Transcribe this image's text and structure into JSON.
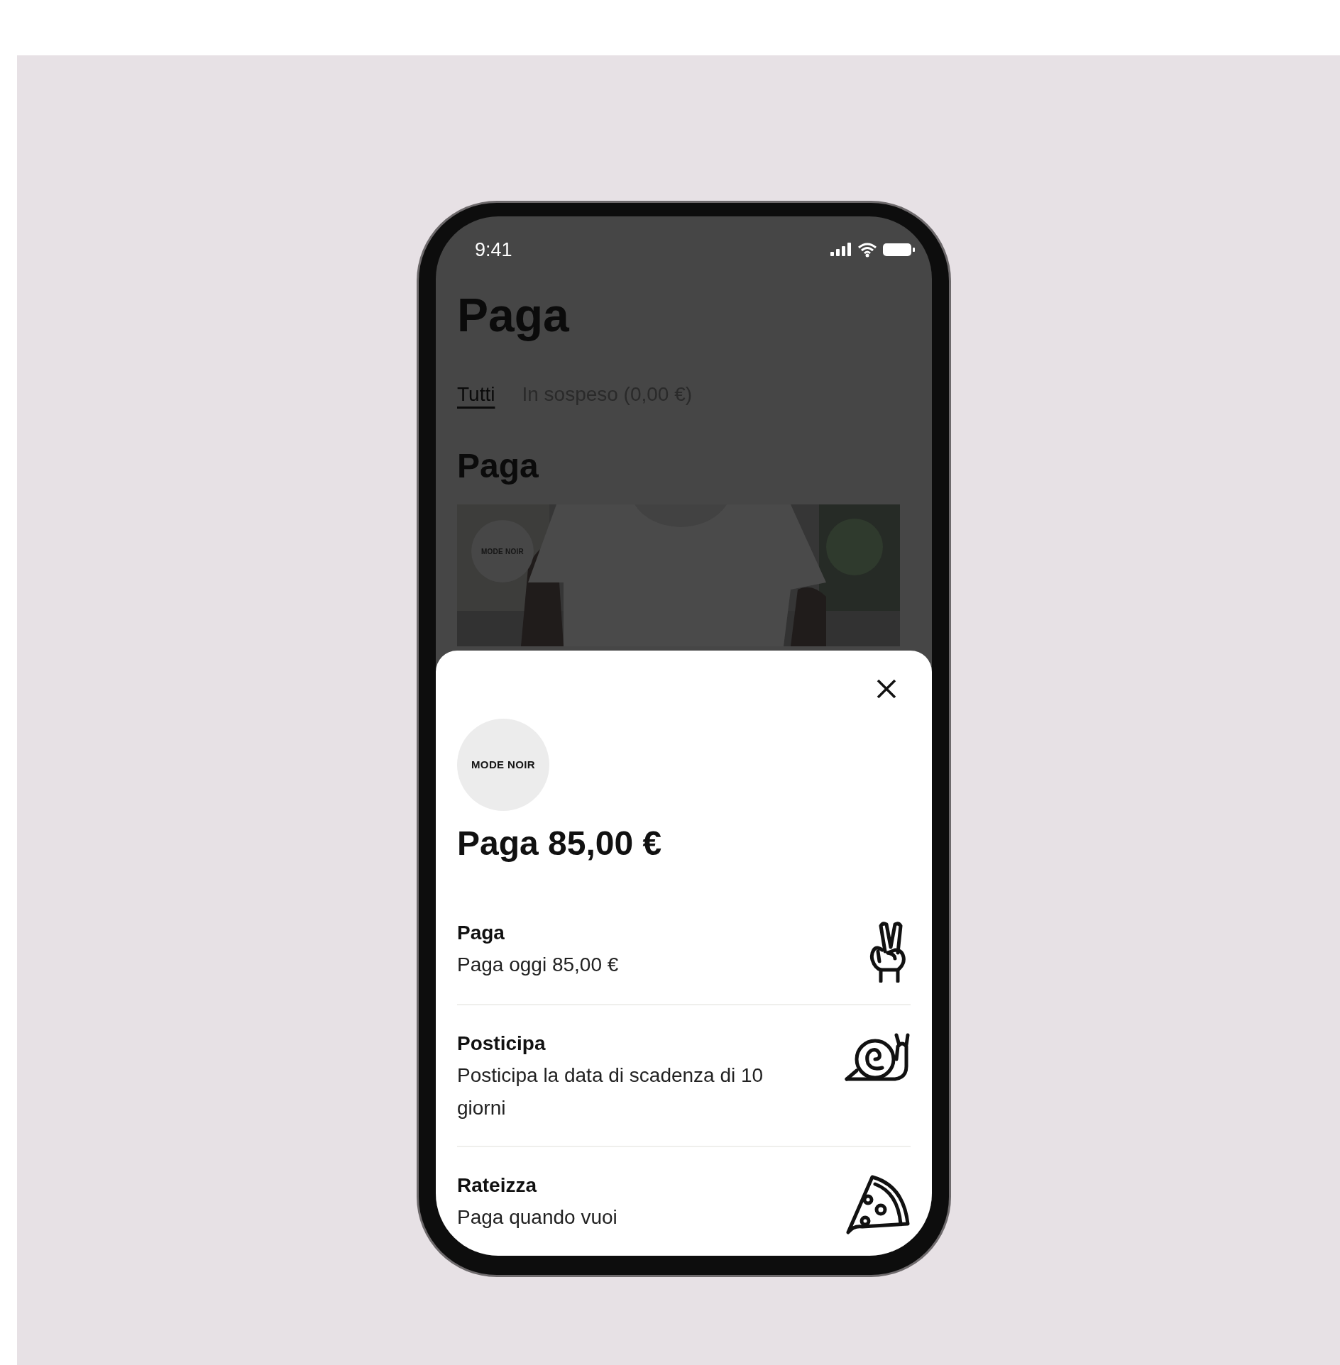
{
  "status_bar": {
    "time": "9:41"
  },
  "title": "Paga",
  "tabs": [
    {
      "label": "Tutti",
      "selected": true
    },
    {
      "label": "In sospeso (0,00 €)",
      "selected": false
    }
  ],
  "section_title": "Paga",
  "merchant_card": {
    "kind": "picture",
    "logo": "MODE NOIR"
  },
  "sheet": {
    "logo": "MODE NOIR",
    "heading": "Paga 85,00 €",
    "options": [
      {
        "title": "Paga",
        "description": "Paga oggi 85,00 €",
        "kind": "hand"
      },
      {
        "title": "Posticipa",
        "description": "Posticipa la data di scadenza di 10 giorni",
        "kind": "snail"
      },
      {
        "title": "Rateizza",
        "description": "Paga quando vuoi",
        "kind": "pizza"
      }
    ]
  }
}
